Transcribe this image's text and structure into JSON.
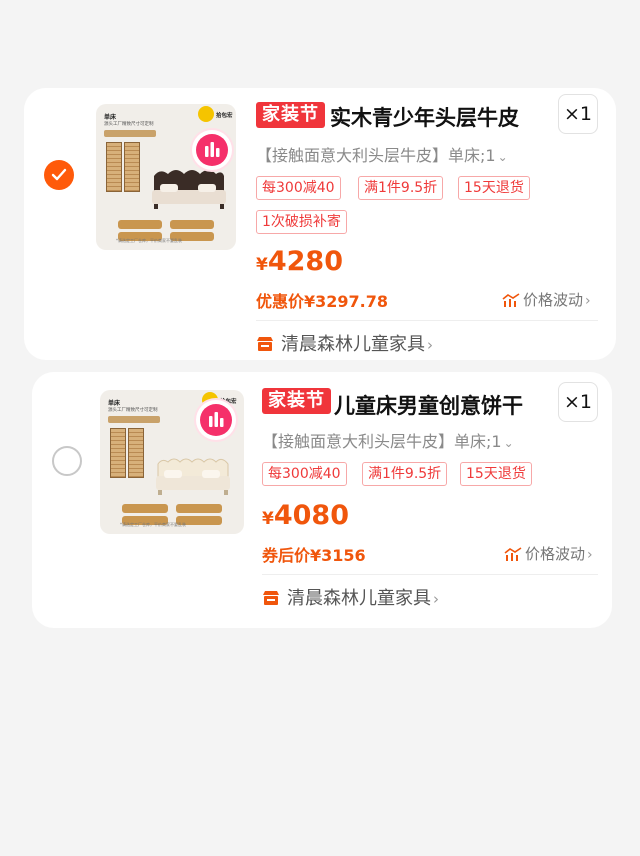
{
  "colors": {
    "accent": "#ff5a0a",
    "price": "#f0560c",
    "promo": "#f0353b",
    "coupon": "#ef3a3a"
  },
  "items": [
    {
      "selected": true,
      "thumb": {
        "brand": "单床",
        "subtitle": "源头工厂精致尺寸可定制",
        "tag": "10公分排骨架床架",
        "brand_badge": "拾包宏",
        "footer": "*请选定工厂仓库，平价商家不要乱装"
      },
      "promo_tag": "家装节",
      "title": "实木青少年头层牛皮",
      "quantity": "×1",
      "spec": "【接触面意大利头层牛皮】单床;1",
      "coupons": [
        "每300减40",
        "满1件9.5折",
        "15天退货",
        "1次破损补寄"
      ],
      "price_symbol": "¥",
      "price": "4280",
      "discount_label": "优惠价¥3297.78",
      "trend_label": "价格波动",
      "shop_name": "清晨森林儿童家具"
    },
    {
      "selected": false,
      "thumb": {
        "brand": "单床",
        "subtitle": "源头工厂精致尺寸可定制",
        "tag": "10公分排骨架床架",
        "brand_badge": "拾包宏",
        "footer": "*请选定工厂仓库，平价商家不要乱装"
      },
      "promo_tag": "家装节",
      "title": "儿童床男童创意饼干",
      "quantity": "×1",
      "spec": "【接触面意大利头层牛皮】单床;1",
      "coupons": [
        "每300减40",
        "满1件9.5折",
        "15天退货"
      ],
      "price_symbol": "¥",
      "price": "4080",
      "discount_label": "券后价¥3156",
      "trend_label": "价格波动",
      "shop_name": "清晨森林儿童家具"
    }
  ]
}
